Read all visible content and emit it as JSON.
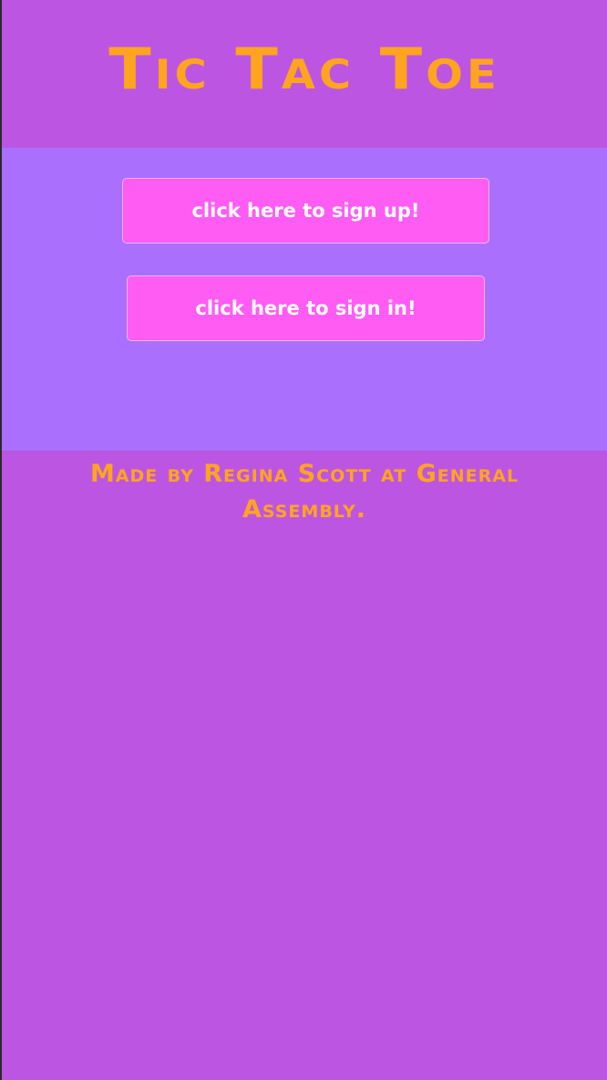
{
  "header": {
    "title": "Tic Tac Toe"
  },
  "auth": {
    "signup_label": "click here to sign up!",
    "signin_label": "click here to sign in!"
  },
  "footer": {
    "credit": "Made by Regina Scott at General Assembly."
  },
  "colors": {
    "page_background": "#bc56e2",
    "panel_background": "#aa70fd",
    "button_background": "#ff5cf4",
    "button_text": "#ffffff",
    "accent_text": "#ffa41f"
  }
}
